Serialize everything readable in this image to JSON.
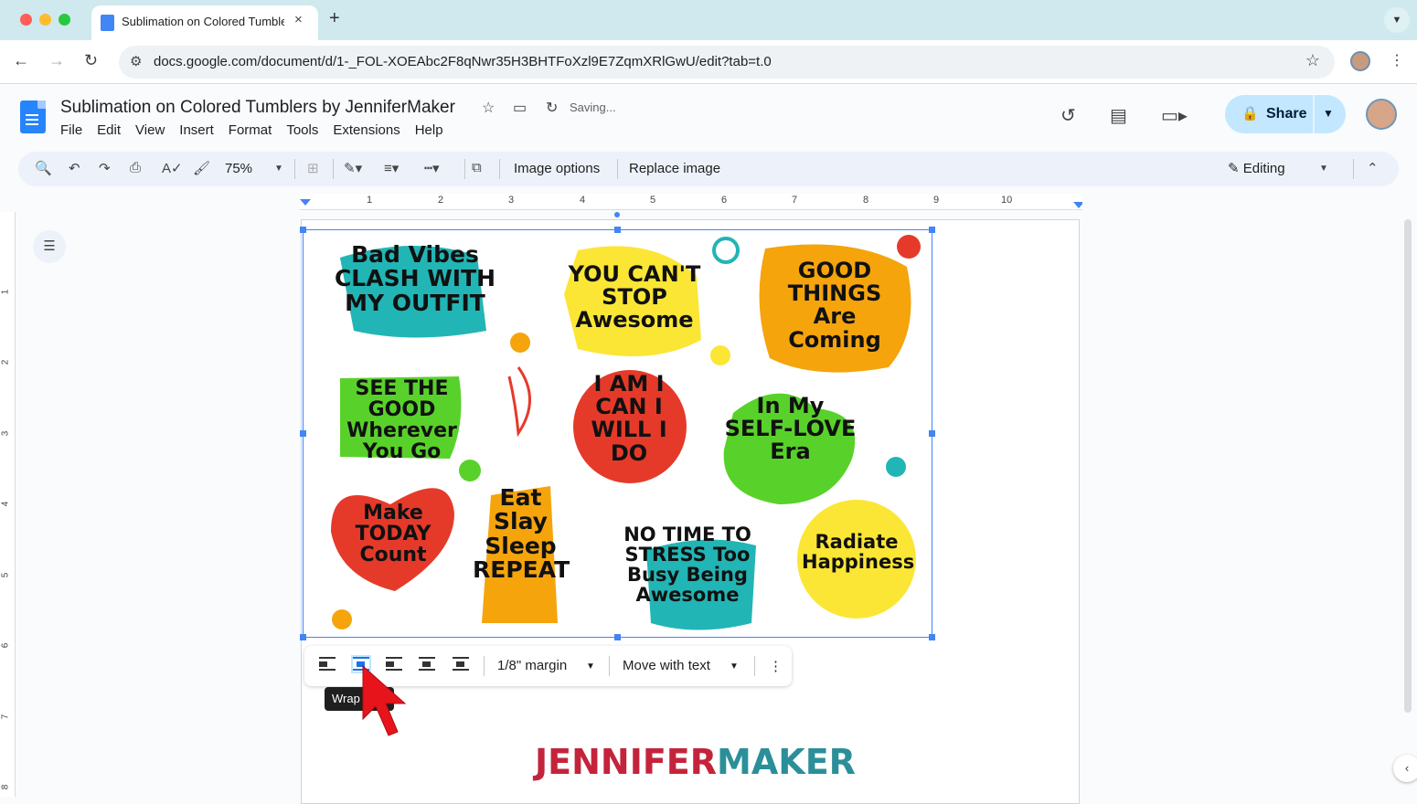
{
  "browser": {
    "tab_title": "Sublimation on Colored Tumblers by JenniferMaker",
    "tab_close": "×",
    "new_tab": "+",
    "url": "docs.google.com/document/d/1-_FOL-XOEAbc2F8qNwr35H3BHTFoXzl9E7ZqmXRlGwU/edit?tab=t.0"
  },
  "doc": {
    "title": "Sublimation on Colored Tumblers by JenniferMaker",
    "status": "Saving...",
    "menu": [
      "File",
      "Edit",
      "View",
      "Insert",
      "Format",
      "Tools",
      "Extensions",
      "Help"
    ],
    "share_label": "Share"
  },
  "toolbar": {
    "zoom": "75%",
    "image_options": "Image options",
    "replace_image": "Replace image",
    "mode": "Editing"
  },
  "ruler": {
    "numbers": [
      "1",
      "2",
      "3",
      "4",
      "5",
      "6",
      "7",
      "8",
      "9",
      "10"
    ],
    "vertical_numbers": [
      "1",
      "2",
      "3",
      "4",
      "5",
      "6",
      "7",
      "8"
    ]
  },
  "image": {
    "stickers": [
      "Bad Vibes CLASH WITH MY OUTFIT",
      "YOU CAN'T STOP Awesome",
      "GOOD THINGS Are Coming",
      "SEE THE GOOD Wherever You Go",
      "I AM I CAN I WILL I DO",
      "In My SELF-LOVE Era",
      "Make TODAY Count",
      "Eat Slay Sleep REPEAT",
      "NO TIME TO STRESS Too Busy Being Awesome",
      "Radiate Happiness"
    ]
  },
  "image_bar": {
    "margin": "1/8\" margin",
    "position": "Move with text",
    "tooltip": "Wrap text"
  },
  "footer_brand": {
    "part1": "JENNIFER",
    "part2": "MAKER"
  },
  "colors": {
    "selection": "#4285f4",
    "brand_red": "#c4243b",
    "brand_teal": "#2b8f99"
  }
}
